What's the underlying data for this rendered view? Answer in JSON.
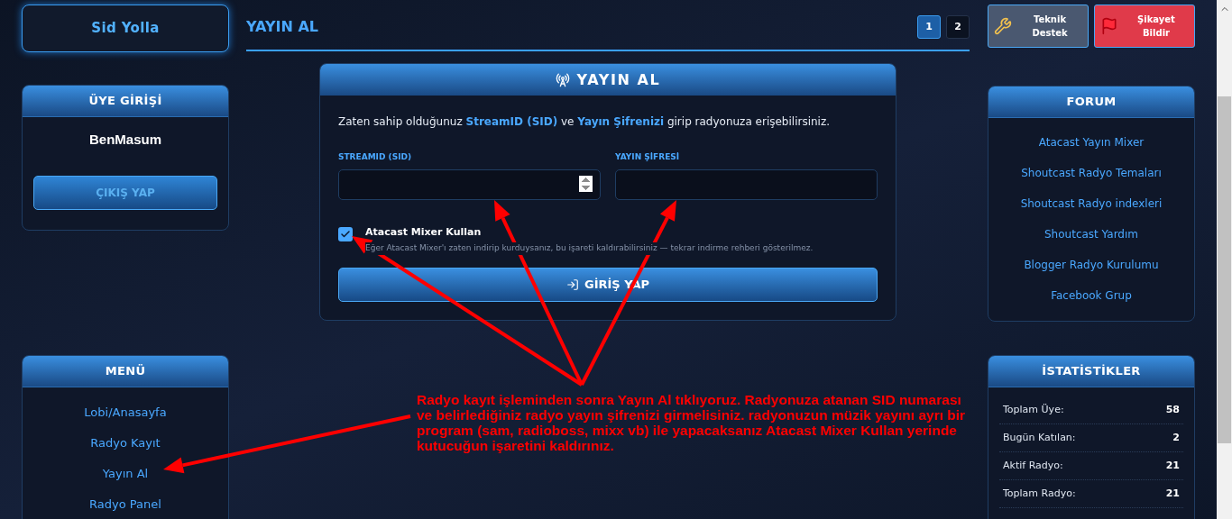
{
  "left": {
    "brand": "Sid Yolla",
    "login_panel": {
      "title": "ÜYE GİRİŞİ",
      "username": "BenMasum",
      "logout_button": "ÇIKIŞ YAP"
    },
    "menu_panel": {
      "title": "MENÜ",
      "items": [
        {
          "label": "Lobi/Anasayfa"
        },
        {
          "label": "Radyo Kayıt"
        },
        {
          "label": "Yayın Al"
        },
        {
          "label": "Radyo Panel"
        }
      ]
    }
  },
  "main": {
    "title": "YAYIN AL",
    "pages": [
      {
        "label": "1",
        "selected": true
      },
      {
        "label": "2",
        "selected": false
      }
    ],
    "card": {
      "title": "YAYIN AL",
      "intro": "Zaten sahip olduğunuz **StreamID (SID)** ve **Yayın Şifrenizi** girip radyonuza erişebilirsiniz.",
      "sid_label": "STREAMID (SID)",
      "password_label": "YAYIN ŞİFRESİ",
      "mixer_option": {
        "label": "Atacast Mixer Kullan",
        "checked": true,
        "hint": "Eğer Atacast Mixer'ı zaten indirip kurduysanız, bu işareti kaldırabilirsiniz — tekrar indirme rehberi gösterilmez."
      },
      "submit_button": "GİRİŞ YAP"
    }
  },
  "right": {
    "support_button": "Teknik Destek",
    "complaint_button": "Şikayet Bildir",
    "forum_panel": {
      "title": "FORUM",
      "links": [
        {
          "label": "Atacast Yayın Mixer"
        },
        {
          "label": "Shoutcast Radyo Temaları"
        },
        {
          "label": "Shoutcast Radyo indexleri"
        },
        {
          "label": "Shoutcast Yardım"
        },
        {
          "label": "Blogger Radyo Kurulumu"
        },
        {
          "label": "Facebook Grup"
        }
      ]
    },
    "stats_panel": {
      "title": "İSTATİSTİKLER",
      "rows": [
        {
          "label": "Toplam Üye:",
          "value": "58"
        },
        {
          "label": "Bugün Katılan:",
          "value": "2"
        },
        {
          "label": "Aktif Radyo:",
          "value": "21"
        },
        {
          "label": "Toplam Radyo:",
          "value": "21"
        }
      ]
    }
  },
  "annotation": {
    "lines": [
      "Radyo kayıt işleminden sonra Yayın Al tıklıyoruz. Radyonuza atanan SID numarası",
      "ve belirlediğiniz radyo yayın şifrenizi girmelisiniz. radyonuzun müzik yayını ayrı bir",
      "program (sam, radioboss, mixx vb) ile yapacaksanız Atacast Mixer Kullan yerinde",
      "kutucuğun işaretini kaldırınız."
    ]
  }
}
